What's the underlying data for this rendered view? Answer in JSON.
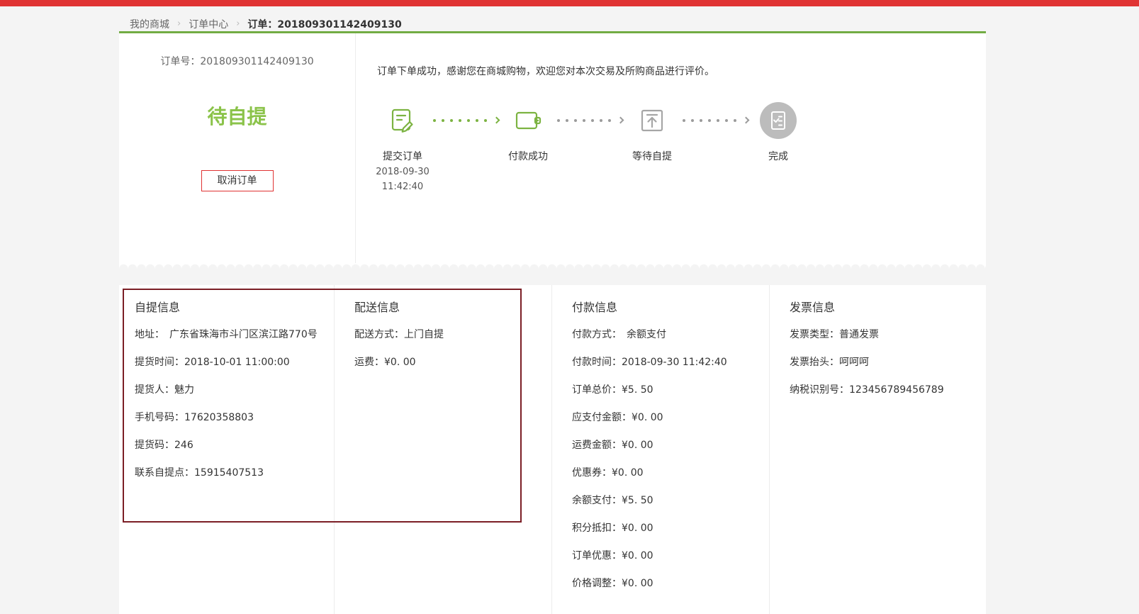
{
  "colors": {
    "topbar_red": "#e03333",
    "accent_green": "#7cb342",
    "status_green": "#8bc34a",
    "cancel_border_red": "#e03333",
    "annotation_red": "#7b1e25"
  },
  "breadcrumb": {
    "items": [
      "我的商城",
      "订单中心"
    ],
    "separator": "›",
    "current": "订单：201809301142409130"
  },
  "summary": {
    "order_no_line": "订单号：201809301142409130",
    "status": "待自提",
    "cancel_button": "取消订单"
  },
  "progress": {
    "message": "订单下单成功，感谢您在商城购物，欢迎您对本次交易及所购商品进行评价。",
    "steps": [
      {
        "label": "提交订单",
        "date": "2018-09-30",
        "time": "11:42:40",
        "icon": "order-document-edit-icon",
        "state": "done"
      },
      {
        "label": "付款成功",
        "icon": "wallet-icon",
        "state": "done"
      },
      {
        "label": "等待自提",
        "icon": "pickup-upload-box-icon",
        "state": "pending"
      },
      {
        "label": "完成",
        "icon": "complete-receipt-circle-icon",
        "state": "pending"
      }
    ]
  },
  "sections": [
    {
      "title": "自提信息",
      "rows": [
        "地址：　广东省珠海市斗门区滨江路770号",
        "提货时间：2018-10-01 11:00:00",
        "提货人：魅力",
        "手机号码：17620358803",
        "提货码：246",
        "联系自提点：15915407513"
      ]
    },
    {
      "title": "配送信息",
      "rows": [
        "配送方式：上门自提",
        "运费：¥0. 00"
      ]
    },
    {
      "title": "付款信息",
      "rows": [
        "付款方式：　余额支付",
        "付款时间：2018-09-30 11:42:40",
        "订单总价：¥5. 50",
        "应支付金额：¥0. 00",
        "运费金额：¥0. 00",
        "优惠券：¥0. 00",
        "余额支付：¥5. 50",
        "积分抵扣：¥0. 00",
        "订单优惠：¥0. 00",
        "价格调整：¥0. 00"
      ]
    },
    {
      "title": "发票信息",
      "rows": [
        "发票类型：普通发票",
        "发票抬头：呵呵呵",
        "纳税识别号：123456789456789"
      ]
    }
  ]
}
